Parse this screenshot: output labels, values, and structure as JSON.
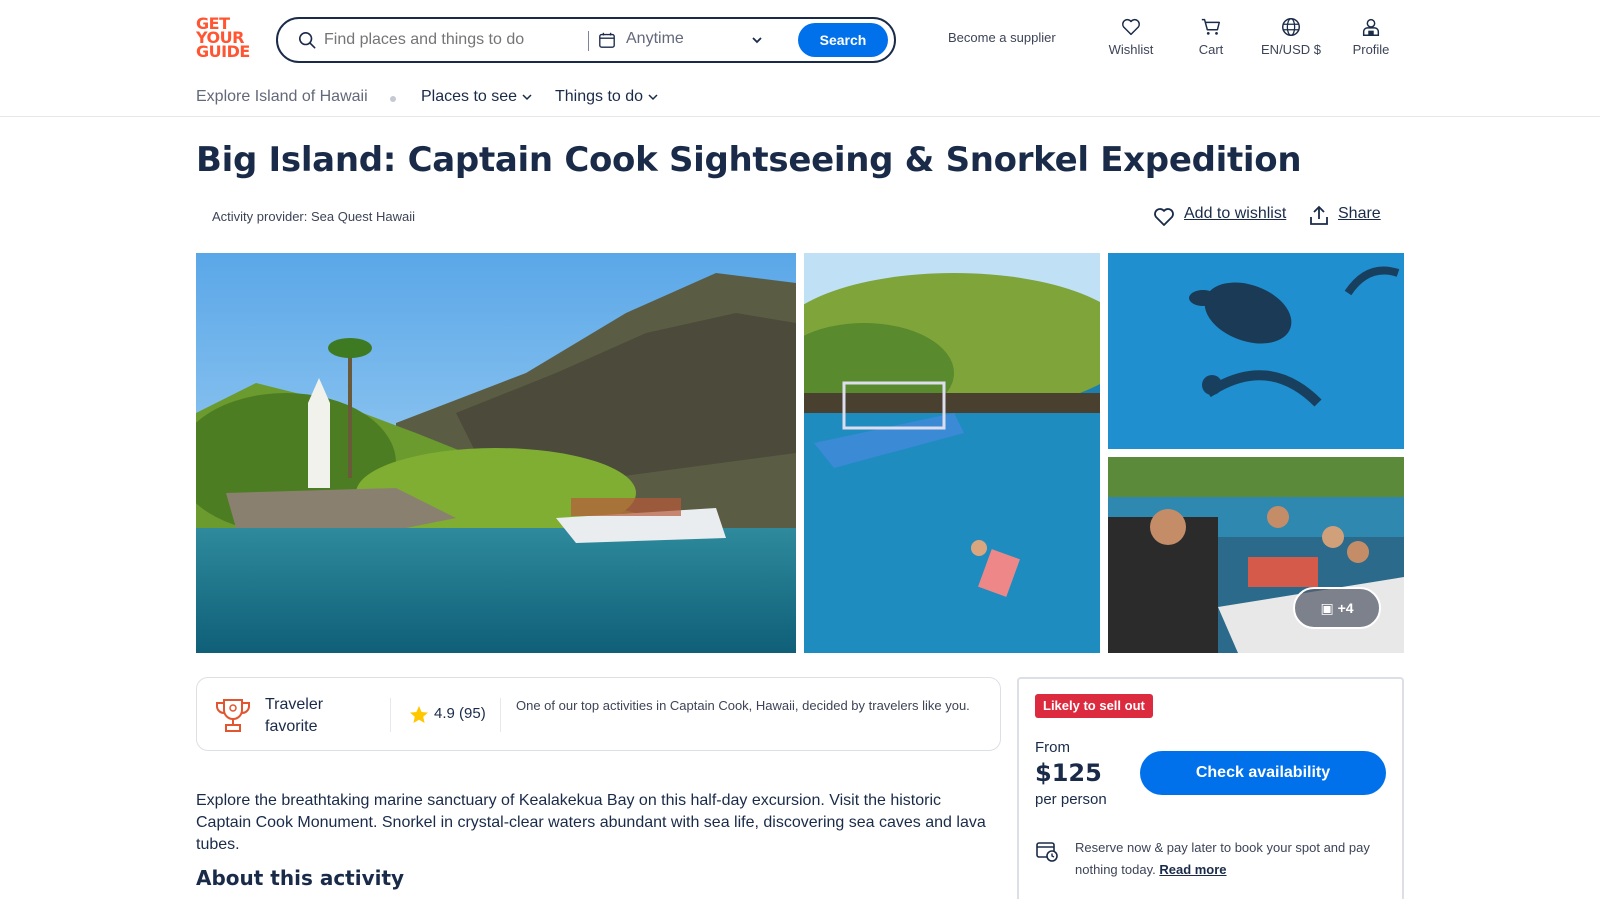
{
  "header": {
    "logo_lines": [
      "GET",
      "YOUR",
      "GUIDE"
    ],
    "search_placeholder": "Find places and things to do",
    "date_label": "Anytime",
    "search_button": "Search",
    "supplier_link": "Become a supplier",
    "nav": [
      {
        "label": "Wishlist",
        "icon": "heart-icon"
      },
      {
        "label": "Cart",
        "icon": "cart-icon"
      },
      {
        "label": "EN/USD $",
        "icon": "globe-icon"
      },
      {
        "label": "Profile",
        "icon": "profile-icon"
      }
    ]
  },
  "subnav": {
    "breadcrumb": "Explore Island of Hawaii",
    "menus": [
      "Places to see",
      "Things to do"
    ]
  },
  "activity": {
    "title": "Big Island: Captain Cook Sightseeing & Snorkel Expedition",
    "provider": "Activity provider: Sea Quest Hawaii",
    "wishlist_label": "Add to wishlist",
    "share_label": "Share",
    "more_photos": "+4"
  },
  "favorite": {
    "label": "Traveler favorite",
    "rating": "4.9",
    "reviews": "(95)",
    "description": "One of our top activities in Captain Cook, Hawaii, decided by travelers like you."
  },
  "summary": "Explore the breathtaking marine sanctuary of Kealakekua Bay on this half-day excursion. Visit the historic Captain Cook Monument. Snorkel in crystal-clear waters abundant with sea life, discovering sea caves and lava tubes.",
  "about_heading": "About this activity",
  "booking": {
    "badge": "Likely to sell out",
    "from": "From",
    "price": "$125",
    "per": "per person",
    "cta": "Check availability",
    "reserve_text": "Reserve now & pay later to book your spot and pay nothing today.",
    "read_more": "Read more"
  },
  "colors": {
    "brand": "#ff5533",
    "primary": "#0071eb",
    "text": "#1a2b49",
    "badge": "#dc2a3e"
  }
}
